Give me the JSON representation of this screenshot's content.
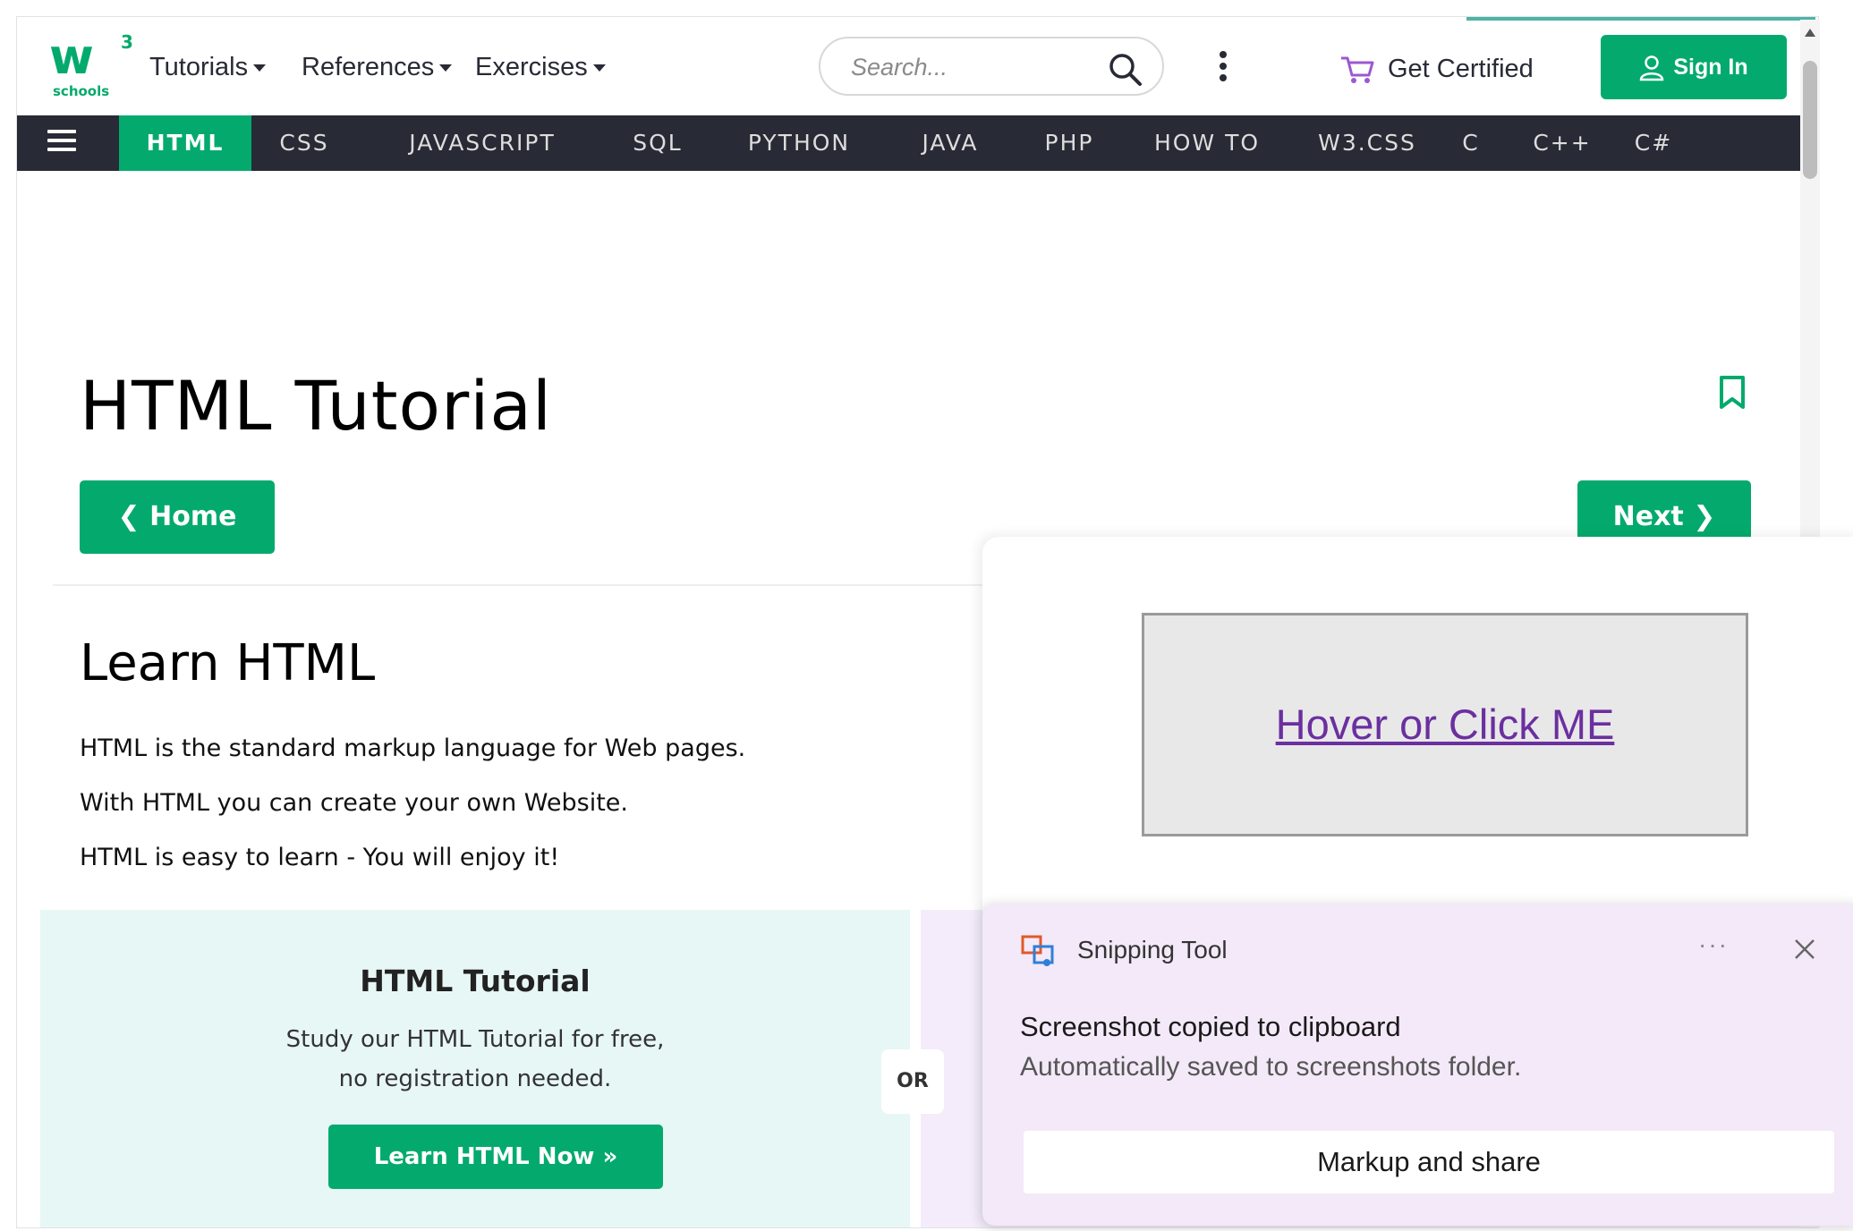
{
  "logo": {
    "mark": "w",
    "superscript": "3",
    "subtext": "schools"
  },
  "header": {
    "menus": [
      {
        "label": "Tutorials"
      },
      {
        "label": "References"
      },
      {
        "label": "Exercises"
      }
    ],
    "search": {
      "placeholder": "Search...",
      "value": ""
    },
    "get_certified": "Get Certified",
    "sign_in": "Sign In"
  },
  "subnav": {
    "tabs": [
      "HTML",
      "CSS",
      "JAVASCRIPT",
      "SQL",
      "PYTHON",
      "JAVA",
      "PHP",
      "HOW TO",
      "W3.CSS",
      "C",
      "C++",
      "C#"
    ],
    "active": "HTML"
  },
  "page": {
    "title": "HTML Tutorial",
    "home_button": "❮ Home",
    "next_button": "Next ❯",
    "section_title": "Learn HTML",
    "paragraphs": [
      "HTML is the standard markup language for Web pages.",
      "With HTML you can create your own Website.",
      "HTML is easy to learn - You will enjoy it!"
    ]
  },
  "tutorial_card": {
    "heading": "HTML Tutorial",
    "line1": "Study our HTML Tutorial for free,",
    "line2": "no registration needed.",
    "button": "Learn HTML Now »"
  },
  "or_badge": "OR",
  "popup": {
    "link_text": "Hover or Click ME"
  },
  "toast": {
    "app_name": "Snipping Tool",
    "more": "···",
    "title": "Screenshot copied to clipboard",
    "subtitle": "Automatically saved to screenshots folder.",
    "action": "Markup and share"
  },
  "colors": {
    "brand_green": "#04AA6D",
    "nav_dark": "#282A35",
    "card_mint": "#E7F7F5",
    "card_lavender": "#F4ECFB",
    "toast_bg": "#F3E9F8",
    "link_purple": "#6b2fa0"
  },
  "icons": [
    "search-icon",
    "kebab-menu-icon",
    "cart-icon",
    "user-icon",
    "hamburger-icon",
    "bookmark-icon",
    "snipping-tool-icon",
    "close-icon"
  ]
}
